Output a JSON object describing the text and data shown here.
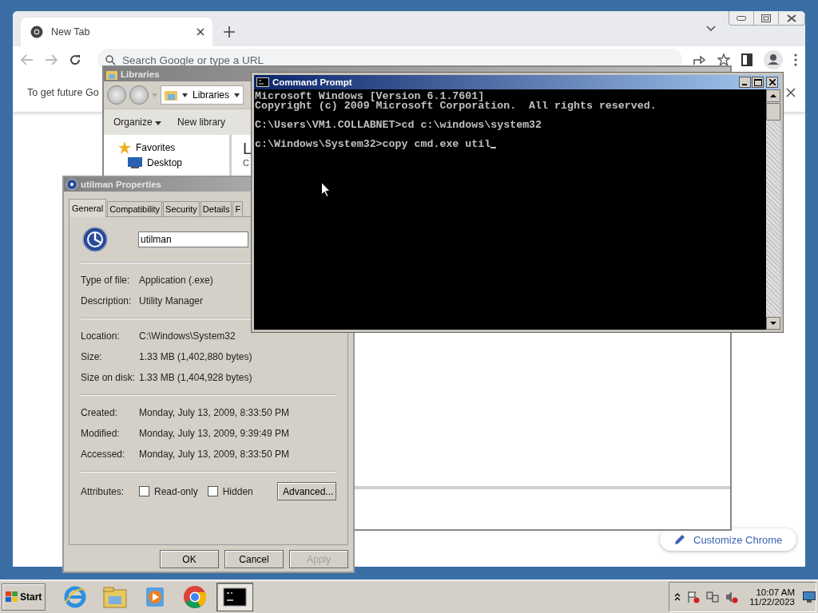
{
  "chrome": {
    "tab": {
      "title": "New Tab"
    },
    "omnibox": {
      "placeholder": "Search Google or type a URL"
    },
    "infobar": {
      "text": "To get future Go"
    },
    "customize_button": "Customize Chrome"
  },
  "libraries": {
    "title": "Libraries",
    "breadcrumb": "Libraries",
    "toolbar": [
      {
        "label": "Organize",
        "menu": true
      },
      {
        "label": "New library",
        "menu": false
      }
    ],
    "nav": [
      {
        "label": "Favorites",
        "kind": "favorites"
      },
      {
        "label": "Desktop",
        "kind": "desktop"
      }
    ],
    "content": {
      "heading": "L",
      "subtitle": "C"
    }
  },
  "properties": {
    "title": "utilman Properties",
    "tabs": [
      {
        "label": "General",
        "selected": true
      },
      {
        "label": "Compatibility",
        "selected": false
      },
      {
        "label": "Security",
        "selected": false
      },
      {
        "label": "Details",
        "selected": false
      },
      {
        "label": "F",
        "selected": false
      }
    ],
    "name": "utilman",
    "groups": [
      [
        {
          "label": "Type of file:",
          "value": "Application (.exe)"
        },
        {
          "label": "Description:",
          "value": "Utility Manager"
        }
      ],
      [
        {
          "label": "Location:",
          "value": "C:\\Windows\\System32"
        },
        {
          "label": "Size:",
          "value": "1.33 MB (1,402,880 bytes)"
        },
        {
          "label": "Size on disk:",
          "value": "1.33 MB (1,404,928 bytes)"
        }
      ],
      [
        {
          "label": "Created:",
          "value": "Monday, July 13, 2009, 8:33:50 PM"
        },
        {
          "label": "Modified:",
          "value": "Monday, July 13, 2009, 9:39:49 PM"
        },
        {
          "label": "Accessed:",
          "value": "Monday, July 13, 2009, 8:33:50 PM"
        }
      ]
    ],
    "attributes": {
      "label": "Attributes:",
      "checkboxes": [
        {
          "label": "Read-only",
          "checked": false
        },
        {
          "label": "Hidden",
          "checked": false
        }
      ],
      "advanced": "Advanced..."
    },
    "buttons": [
      {
        "label": "OK",
        "disabled": false
      },
      {
        "label": "Cancel",
        "disabled": false
      },
      {
        "label": "Apply",
        "disabled": true
      }
    ]
  },
  "cmd": {
    "title": "Command Prompt",
    "blocks": [
      [
        "Microsoft Windows [Version 6.1.7601]",
        "Copyright (c) 2009 Microsoft Corporation.  All rights reserved."
      ],
      [
        "C:\\Users\\VM1.COLLABNET>cd c:\\windows\\system32"
      ],
      [
        "c:\\Windows\\System32>copy cmd.exe util"
      ]
    ]
  },
  "taskbar": {
    "start": "Start",
    "apps": [
      {
        "kind": "ie",
        "selected": false
      },
      {
        "kind": "explorer",
        "selected": false
      },
      {
        "kind": "media",
        "selected": false
      },
      {
        "kind": "chrome",
        "selected": false
      },
      {
        "kind": "cmd",
        "selected": true
      }
    ],
    "clock": {
      "time": "10:07 AM",
      "date": "11/22/2023"
    }
  }
}
